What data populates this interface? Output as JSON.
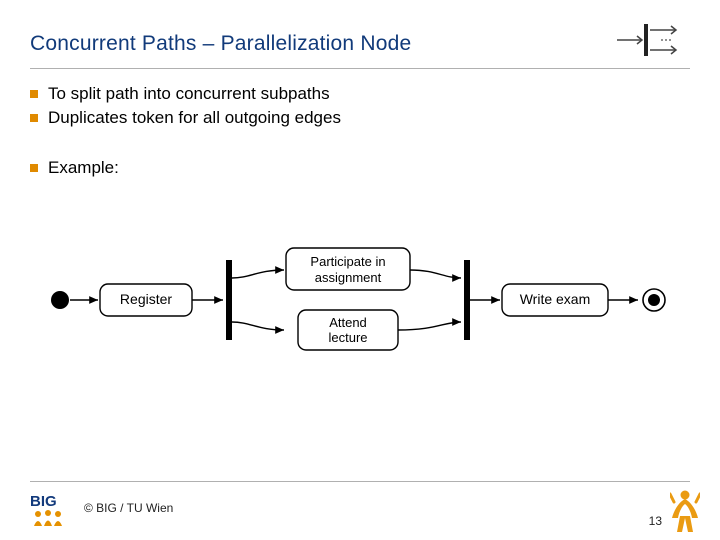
{
  "title": "Concurrent Paths – Parallelization Node",
  "bullets": [
    "To split path into concurrent subpaths",
    "Duplicates token for all outgoing edges"
  ],
  "example_label": "Example:",
  "diagram": {
    "actions": {
      "register": "Register",
      "participate": "Participate in assignment",
      "attend": "Attend lecture",
      "write_exam": "Write exam"
    }
  },
  "footer": {
    "copyright": "© BIG / TU Wien",
    "page": "13",
    "logo_text_big": "BIG"
  },
  "colors": {
    "accent_blue": "#113a7a",
    "accent_orange": "#e08a00"
  }
}
